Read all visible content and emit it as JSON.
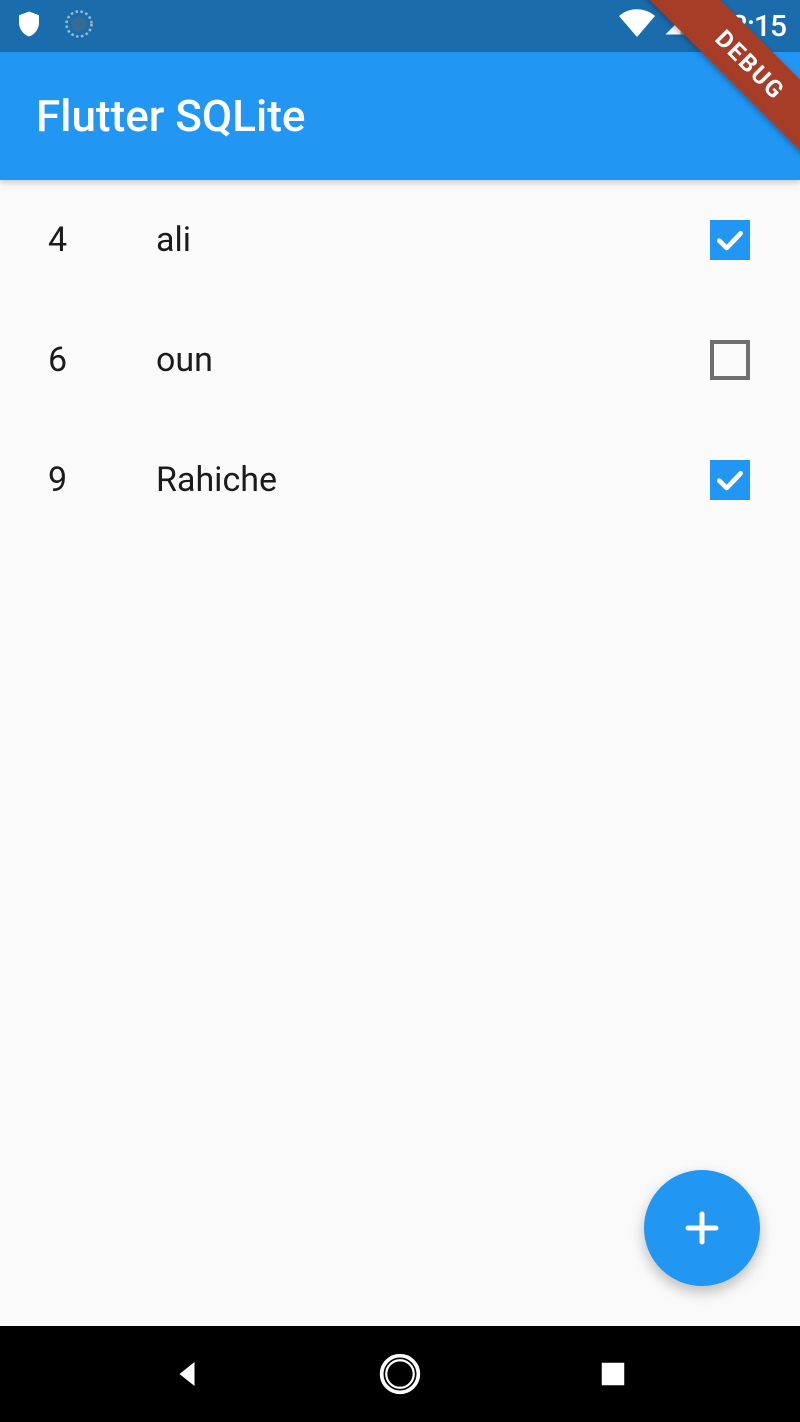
{
  "status_bar": {
    "time": "3:15"
  },
  "app_bar": {
    "title": "Flutter SQLite"
  },
  "list_items": [
    {
      "id": "4",
      "name": "ali",
      "checked": true
    },
    {
      "id": "6",
      "name": "oun",
      "checked": false
    },
    {
      "id": "9",
      "name": "Rahiche",
      "checked": true
    }
  ],
  "debug_banner": "DEBUG",
  "colors": {
    "primary": "#2196f3",
    "status_bar": "#1a6cad",
    "debug_banner": "#a73c27"
  }
}
